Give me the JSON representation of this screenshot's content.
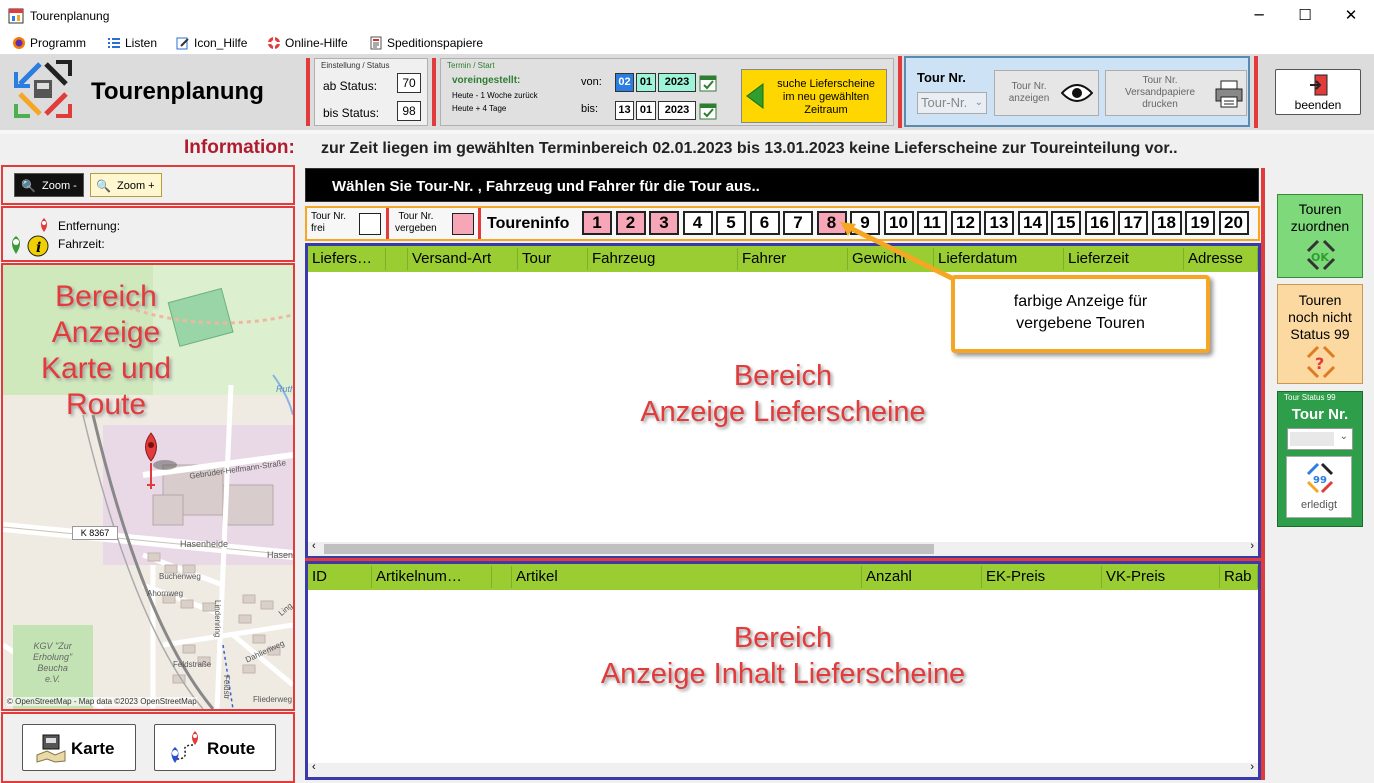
{
  "window": {
    "title": "Tourenplanung",
    "controls": [
      "─",
      "☐",
      "✕"
    ]
  },
  "menu": [
    {
      "label": "Programm",
      "icon": "firefox-icon"
    },
    {
      "label": "Listen",
      "icon": "list-icon"
    },
    {
      "label": "Icon_Hilfe",
      "icon": "edit-icon"
    },
    {
      "label": "Online-Hilfe",
      "icon": "lifebuoy-icon"
    },
    {
      "label": "Speditionspapiere",
      "icon": "document-icon"
    }
  ],
  "header": {
    "app_title": "Tourenplanung"
  },
  "status": {
    "group_label": "Einstellung / Status",
    "ab_label": "ab Status:",
    "ab_value": "70",
    "bis_label": "bis Status:",
    "bis_value": "98"
  },
  "termin": {
    "group_label": "Termin / Start",
    "preset_label": "voreingestellt:",
    "preset_line1": "Heute - 1 Woche zurück",
    "preset_line2": "Heute + 4 Tage",
    "von_label": "von:",
    "von_day": "02",
    "von_month": "01",
    "von_year": "2023",
    "bis_label": "bis:",
    "bis_day": "13",
    "bis_month": "01",
    "bis_year": "2023"
  },
  "search_button": {
    "line1": "suche Lieferscheine",
    "line2": "im neu gewählten",
    "line3": "Zeitraum"
  },
  "tour": {
    "label": "Tour Nr.",
    "select_placeholder": "Tour-Nr.",
    "show_line1": "Tour Nr.",
    "show_line2": "anzeigen",
    "print_line1": "Tour Nr.",
    "print_line2": "Versandpapiere",
    "print_line3": "drucken"
  },
  "exit_button": "beenden",
  "info": {
    "label": "Information:",
    "text": "zur Zeit liegen im gewählten Terminbereich  02.01.2023 bis 13.01.2023 keine Lieferscheine zur Toureinteilung vor.."
  },
  "left": {
    "zoom_out": "Zoom -",
    "zoom_in": "Zoom +",
    "distance_label": "Entfernung:",
    "time_label": "Fahrzeit:",
    "map_overlay": [
      "Bereich",
      "Anzeige",
      "Karte und",
      "Route"
    ],
    "map_credit": "© OpenStreetMap - Map data ©2023 OpenStreetMap",
    "map_labels": [
      "Gebrüder-Helfmann-Straße",
      "K 8367",
      "Hasenheide",
      "Hasenh",
      "Buchenweg",
      "Ahornweg",
      "Lindenring",
      "Feldstraße",
      "Dahlienweg",
      "Fliederweg",
      "KGV \"Zur",
      "Erholung\"",
      "Beucha",
      "e.V.",
      "Ruth",
      "Ling",
      "Feldstr"
    ],
    "btn_map": "Karte",
    "btn_route": "Route"
  },
  "banner": "Wählen Sie Tour-Nr. , Fahrzeug und Fahrer für die Tour aus..",
  "legend": {
    "free_line1": "Tour Nr.",
    "free_line2": "frei",
    "assigned_line1": "Tour Nr.",
    "assigned_line2": "vergeben",
    "info_label": "Toureninfo"
  },
  "tour_numbers": [
    {
      "n": "1",
      "assigned": true
    },
    {
      "n": "2",
      "assigned": true
    },
    {
      "n": "3",
      "assigned": true
    },
    {
      "n": "4",
      "assigned": false
    },
    {
      "n": "5",
      "assigned": false
    },
    {
      "n": "6",
      "assigned": false
    },
    {
      "n": "7",
      "assigned": false
    },
    {
      "n": "8",
      "assigned": true
    },
    {
      "n": "9",
      "assigned": false
    },
    {
      "n": "10",
      "assigned": false
    },
    {
      "n": "11",
      "assigned": false
    },
    {
      "n": "12",
      "assigned": false
    },
    {
      "n": "13",
      "assigned": false
    },
    {
      "n": "14",
      "assigned": false
    },
    {
      "n": "15",
      "assigned": false
    },
    {
      "n": "16",
      "assigned": false
    },
    {
      "n": "17",
      "assigned": false
    },
    {
      "n": "18",
      "assigned": false
    },
    {
      "n": "19",
      "assigned": false
    },
    {
      "n": "20",
      "assigned": false
    }
  ],
  "grid1": {
    "columns": [
      "Liefers…",
      "",
      "Versand-Art",
      "Tour",
      "Fahrzeug",
      "Fahrer",
      "Gewicht",
      "Lieferdatum",
      "Lieferzeit",
      "Adresse"
    ],
    "overlay": [
      "Bereich",
      "Anzeige Lieferscheine"
    ]
  },
  "callout": {
    "line1": "farbige Anzeige für",
    "line2": "vergebene Touren"
  },
  "grid2": {
    "columns": [
      "ID",
      "Artikelnum…",
      "",
      "Artikel",
      "Anzahl",
      "EK-Preis",
      "VK-Preis",
      "Rab"
    ],
    "overlay": [
      "Bereich",
      "Anzeige Inhalt Lieferscheine"
    ]
  },
  "right": {
    "assign_line1": "Touren",
    "assign_line2": "zuordnen",
    "assign_ok": "OK",
    "notyet_line1": "Touren",
    "notyet_line2": "noch nicht",
    "notyet_line3": "Status 99",
    "status99_group": "Tour Status 99",
    "status99_label": "Tour Nr.",
    "status99_badge": "99",
    "status99_done": "erledigt"
  },
  "colors": {
    "accent_green": "#9acd32",
    "assigned_pink": "#f7a6b8",
    "frame_red": "#e23b3b",
    "callout_orange": "#f5a623",
    "search_yellow": "#ffd700",
    "tour_panel": "#cde3f5"
  }
}
